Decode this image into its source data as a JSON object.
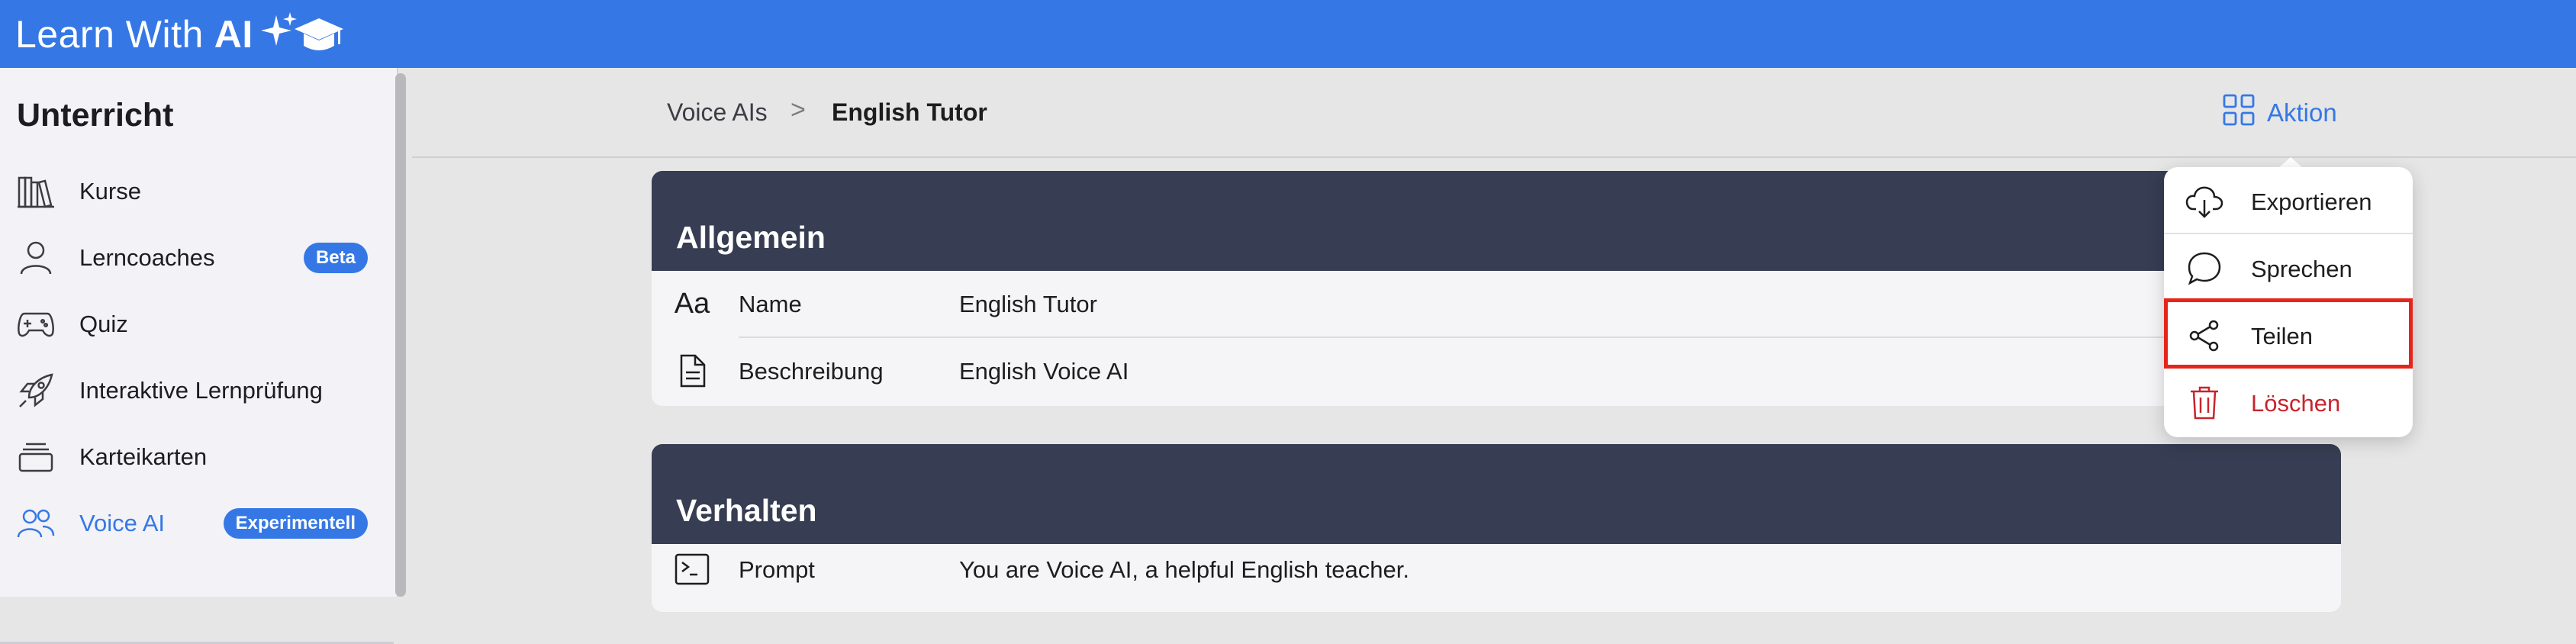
{
  "app": {
    "brand_text": "Learn With",
    "brand_bold": "AI"
  },
  "sidebar": {
    "section_title": "Unterricht",
    "items": [
      {
        "label": "Kurse",
        "icon": "books-icon"
      },
      {
        "label": "Lerncoaches",
        "icon": "person-icon",
        "badge": "Beta"
      },
      {
        "label": "Quiz",
        "icon": "gamepad-icon"
      },
      {
        "label": "Interaktive Lernprüfung",
        "icon": "rocket-icon"
      },
      {
        "label": "Karteikarten",
        "icon": "cards-stack-icon"
      },
      {
        "label": "Voice AI",
        "icon": "people-icon",
        "badge": "Experimentell",
        "active": true
      }
    ]
  },
  "breadcrumb": {
    "parent": "Voice AIs",
    "separator": ">",
    "current": "English Tutor"
  },
  "action": {
    "label": "Aktion",
    "icon": "grid-icon"
  },
  "sections": {
    "general": {
      "title": "Allgemein",
      "rows": [
        {
          "key": "Name",
          "value": "English Tutor",
          "icon": "text-format-icon",
          "icon_text": "Aa"
        },
        {
          "key": "Beschreibung",
          "value": "English Voice AI",
          "icon": "document-icon"
        }
      ]
    },
    "behavior": {
      "title": "Verhalten",
      "rows": [
        {
          "key": "Prompt",
          "value": "You are Voice AI, a helpful English teacher.",
          "icon": "terminal-icon"
        }
      ]
    }
  },
  "menu": {
    "items": [
      {
        "label": "Exportieren",
        "icon": "cloud-download-icon"
      },
      {
        "label": "Sprechen",
        "icon": "speech-bubble-icon"
      },
      {
        "label": "Teilen",
        "icon": "share-icon",
        "highlighted": true
      },
      {
        "label": "Löschen",
        "icon": "trash-icon",
        "destructive": true
      }
    ]
  },
  "colors": {
    "accent": "#3578e5",
    "card_header": "#373d52",
    "destructive": "#c8232c",
    "highlight": "#e5251b"
  }
}
